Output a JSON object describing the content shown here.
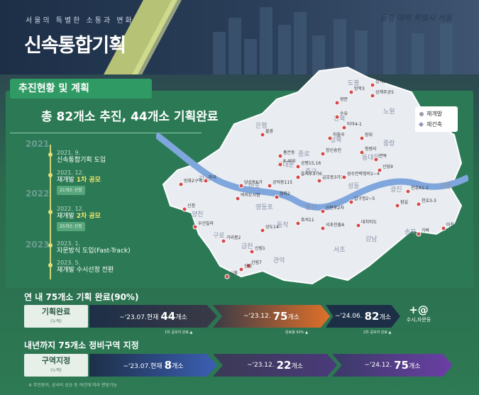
{
  "header": {
    "subtitle": "서울의 특별한 소통과 변화",
    "title": "신속통합기획",
    "slogan": "동행 매력 특별시 서울"
  },
  "section1": {
    "tab": "추진현황 및 계획",
    "headline": "총 82개소 추진, 44개소 기획완료"
  },
  "legend": {
    "redevelop": "재개발",
    "rebuild": "재건축"
  },
  "timeline": {
    "years": [
      "2021",
      "2022",
      "2023"
    ],
    "events": [
      {
        "date": "2021. 9.",
        "text": "신속통합기획 도입"
      },
      {
        "date": "2021. 12.",
        "text_a": "재개발 ",
        "text_b": "1차 공모",
        "badge": "21개소 선정"
      },
      {
        "date": "2022. 12.",
        "text_a": "재개발 ",
        "text_b": "2차 공모",
        "badge": "25개소 선정"
      },
      {
        "date": "2023. 1.",
        "text": "자문방식 도입(Fast-Track)"
      },
      {
        "date": "2023. 5.",
        "text": "재개발 수시선정 전환"
      }
    ]
  },
  "map": {
    "districts": [
      "도봉",
      "노원",
      "강북",
      "은평",
      "성북",
      "중랑",
      "종로",
      "동대문",
      "서대문",
      "마포",
      "중구",
      "성동",
      "광진",
      "강동",
      "용산",
      "강서",
      "영등포",
      "동작",
      "서초",
      "강남",
      "송파",
      "양천",
      "구로",
      "금천",
      "관악"
    ],
    "sites": [
      "상계5",
      "상계주공5",
      "방학3",
      "쌍문",
      "미아4-1",
      "수유",
      "불광",
      "하월곡",
      "청량리",
      "면목",
      "신당9",
      "창신숭인",
      "홍은동",
      "8-400",
      "공평15,16",
      "을지로3가6",
      "금호동3가1",
      "장위",
      "신정",
      "방화2구역",
      "마곡",
      "여의도시범",
      "당산동6가",
      "공덕동115",
      "청파2",
      "흑석11",
      "상도14",
      "신림1",
      "신림7",
      "시흥",
      "압구정2~5",
      "서초진흥A",
      "대치미도",
      "잠실",
      "성수전략정비1~4",
      "천호A1-2",
      "천호3-3",
      "마천",
      "가락",
      "우신빌라",
      "가리봉2",
      "신반포2차",
      "신림"
    ]
  },
  "section2": {
    "title": "연 내 75개소 기획 완료(90%)",
    "label": "기획완료",
    "label_sub": "(누적)",
    "steps": [
      {
        "prefix": "~'23.07.현재",
        "value": "44",
        "unit": "개소",
        "note": "1차 공모지 완료 ▲"
      },
      {
        "prefix": "~'23.12.",
        "value": "75",
        "unit": "개소",
        "note": "완료율 90% ▲"
      },
      {
        "prefix": "~'24.06.",
        "value": "82",
        "unit": "개소",
        "note": "2차 공모지 완료 ▲"
      }
    ],
    "plus": "+@",
    "plus_sub": "수시,자문등"
  },
  "section3": {
    "title": "내년까지 75개소 정비구역 지정",
    "label": "구역지정",
    "label_sub": "(누적)",
    "steps": [
      {
        "prefix": "~'23.07.현재",
        "value": "8",
        "unit": "개소"
      },
      {
        "prefix": "~'23.12.",
        "value": "22",
        "unit": "개소"
      },
      {
        "prefix": "~'24.12.",
        "value": "75",
        "unit": "개소"
      }
    ]
  },
  "footnote": "※ 주민동의, 공사비 상승 등 여건에 따라 변동가능",
  "colors": {
    "bg_green": "#2c7a55",
    "accent_yellow": "#f3e56a",
    "arrow_orange": "#e0702a",
    "arrow_blue": "#3b5fb3",
    "arrow_navy": "#1d2f47"
  }
}
